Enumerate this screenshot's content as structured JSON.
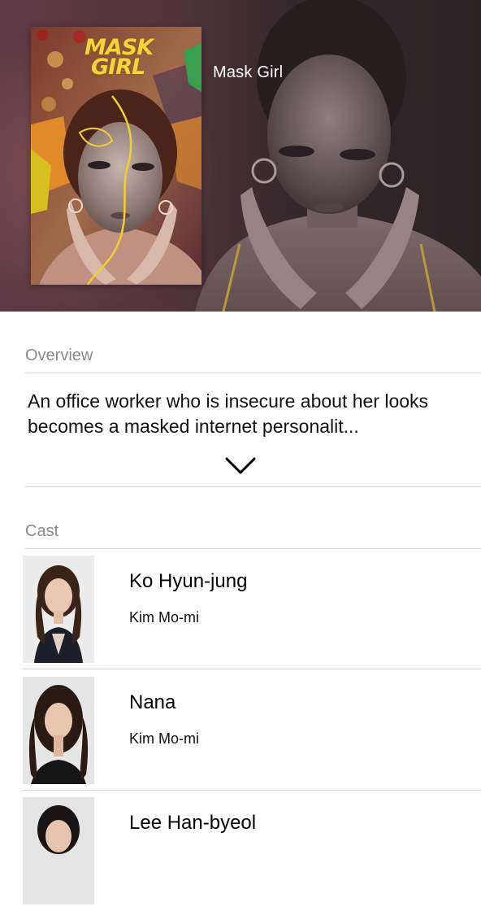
{
  "show": {
    "title": "Mask Girl",
    "poster_title_line1": "MASK",
    "poster_title_line2": "GIRL"
  },
  "overview": {
    "header": "Overview",
    "text": "An office worker who is insecure about her looks becomes a masked internet personalit..."
  },
  "cast": {
    "header": "Cast",
    "members": [
      {
        "name": "Ko Hyun-jung",
        "role": "Kim Mo-mi"
      },
      {
        "name": "Nana",
        "role": "Kim Mo-mi"
      },
      {
        "name": "Lee Han-byeol",
        "role": ""
      }
    ]
  },
  "icons": {
    "expand": "chevron-down-icon"
  },
  "colors": {
    "section_header": "#8a8a8e",
    "poster_title": "#f3d43a",
    "hero_background": "#5a3a40"
  }
}
